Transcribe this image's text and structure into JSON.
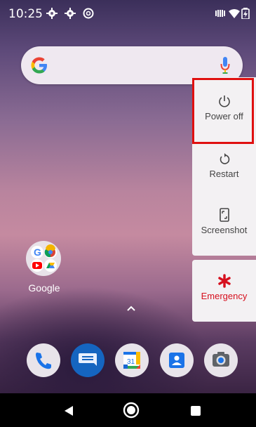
{
  "status_bar": {
    "time": "10:25",
    "left_icons": [
      "gear-icon",
      "gear-icon",
      "data-saver-icon"
    ],
    "right_icons": [
      "vibrate-icon",
      "wifi-icon",
      "battery-charging-icon"
    ]
  },
  "search_bar": {
    "logo": "google-g-icon",
    "mic_icon": "mic-icon"
  },
  "power_menu": {
    "items": [
      {
        "label": "Power off",
        "icon": "power-icon"
      },
      {
        "label": "Restart",
        "icon": "restart-icon"
      },
      {
        "label": "Screenshot",
        "icon": "screenshot-icon"
      }
    ],
    "emergency": {
      "label": "Emergency",
      "icon": "asterisk-icon",
      "color": "#d6101e"
    },
    "highlight_color": "#e01010"
  },
  "home": {
    "folder_label": "Google",
    "drawer_icon": "chevron-up-icon"
  },
  "dock": {
    "apps": [
      "phone-icon",
      "messages-icon",
      "calendar-icon",
      "contacts-icon",
      "camera-icon"
    ],
    "calendar_day": "31"
  },
  "nav_bar": {
    "buttons": [
      "back-icon",
      "home-icon",
      "recents-icon"
    ]
  }
}
